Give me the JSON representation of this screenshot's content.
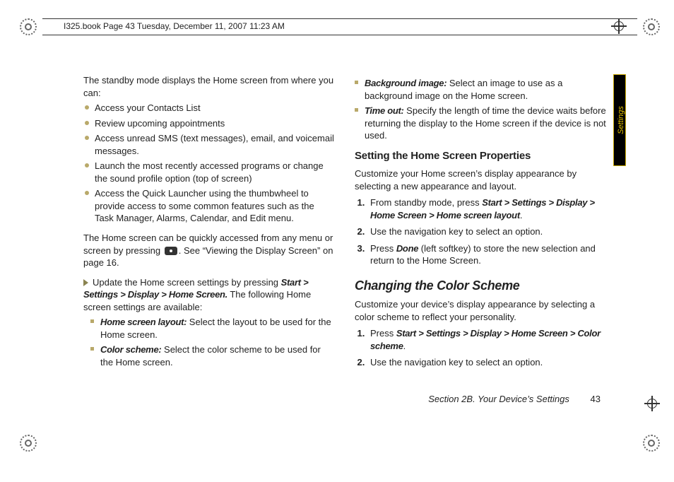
{
  "header": {
    "stamp": "I325.book  Page 43  Tuesday, December 11, 2007  11:23 AM"
  },
  "side_tab": "Settings",
  "left": {
    "intro": "The standby mode displays the Home screen from where you can:",
    "bullets": [
      "Access your Contacts List",
      "Review upcoming appointments",
      "Access unread SMS (text messages), email, and voicemail messages.",
      "Launch the most recently accessed programs or change the sound profile option (top of screen)",
      "Access the Quick Launcher using the thumbwheel to provide access to some common features such as the Task Manager, Alarms, Calendar, and Edit menu."
    ],
    "para2a": "The Home screen can be quickly accessed from any menu or screen by pressing ",
    "para2b": ". See “Viewing the Display Screen” on page 16.",
    "update_lead": "Update the Home screen settings by pressing ",
    "update_path": "Start > Settings > Display > Home Screen.",
    "update_tail": " The following Home screen settings are available:",
    "inner": [
      {
        "label": "Home screen layout:",
        "text": " Select the layout to be used for the Home screen."
      },
      {
        "label": "Color scheme:",
        "text": " Select the color scheme to be used for the Home screen."
      }
    ]
  },
  "right": {
    "inner": [
      {
        "label": "Background image:",
        "text": " Select an image to use as a background image on the Home screen."
      },
      {
        "label": "Time out:",
        "text": " Specify the length of time the device waits before returning the display to the Home screen if the device is not used."
      }
    ],
    "h3a": "Setting the Home Screen Properties",
    "p_a": "Customize your Home screen’s display appearance by selecting a new appearance and layout.",
    "steps_a": [
      {
        "pre": "From standby mode, press ",
        "bold": "Start > Settings > Display > Home Screen > Home screen layout",
        "post": "."
      },
      {
        "pre": "Use the navigation key to select an option.",
        "bold": "",
        "post": ""
      },
      {
        "pre": "Press ",
        "bold": "Done",
        "post": " (left softkey) to store the new selection and return to the Home Screen."
      }
    ],
    "h2": "Changing the Color Scheme",
    "p_b": "Customize your device’s display appearance by selecting a color scheme to reflect your personality.",
    "steps_b": [
      {
        "pre": "Press ",
        "bold": "Start > Settings > Display > Home Screen > Color scheme",
        "post": "."
      },
      {
        "pre": "Use the navigation key to select an option.",
        "bold": "",
        "post": ""
      }
    ]
  },
  "footer": {
    "section": "Section 2B. Your Device’s Settings",
    "page": "43"
  }
}
